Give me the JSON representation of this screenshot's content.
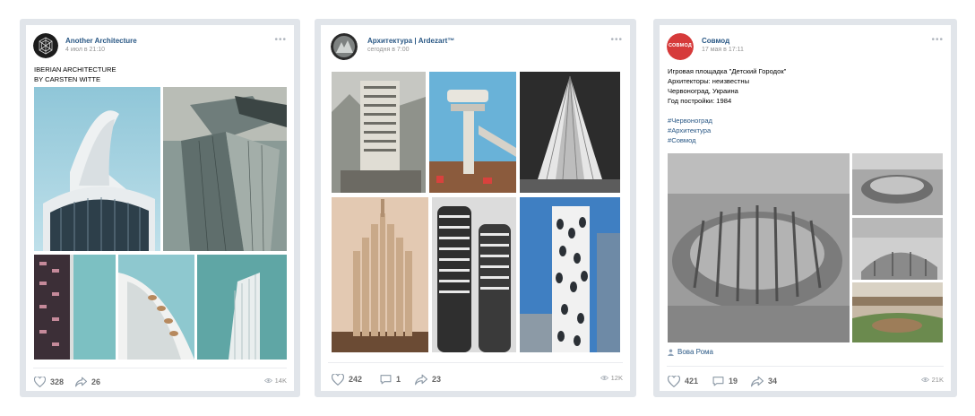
{
  "posts": [
    {
      "author": "Another Architecture",
      "date": "4 июл в 21:10",
      "text": [
        "IBERIAN ARCHITECTURE",
        "BY CARSTEN WITTE"
      ],
      "likes": "328",
      "shares": "26",
      "views": "14K"
    },
    {
      "author": "Архитектура | Ardezart™",
      "date": "сегодня в 7:00",
      "likes": "242",
      "comments": "1",
      "shares": "23",
      "views": "12K"
    },
    {
      "author": "Совмод",
      "avatar_text": "СОВМОД",
      "date": "17 мая в 17:11",
      "text": [
        "Игровая площадка \"Детский Городок\"",
        "Архитекторы: неизвестны",
        "Червоноград, Украина",
        "Год постройки: 1984"
      ],
      "hashtags": [
        "#Червоноград",
        "#Архитектура",
        "#Совмод"
      ],
      "signer": "Вова Рома",
      "likes": "421",
      "comments": "19",
      "shares": "34",
      "views": "21K"
    }
  ],
  "colors": {
    "link": "#2a5885",
    "muted": "#939393",
    "border": "#e1e5ea",
    "accent_sovmod": "#d63a3a"
  },
  "icons": {
    "more": "more-dots-icon",
    "like": "heart-icon",
    "comment": "comment-icon",
    "share": "share-arrow-icon",
    "views": "eye-icon",
    "signer": "user-icon"
  }
}
